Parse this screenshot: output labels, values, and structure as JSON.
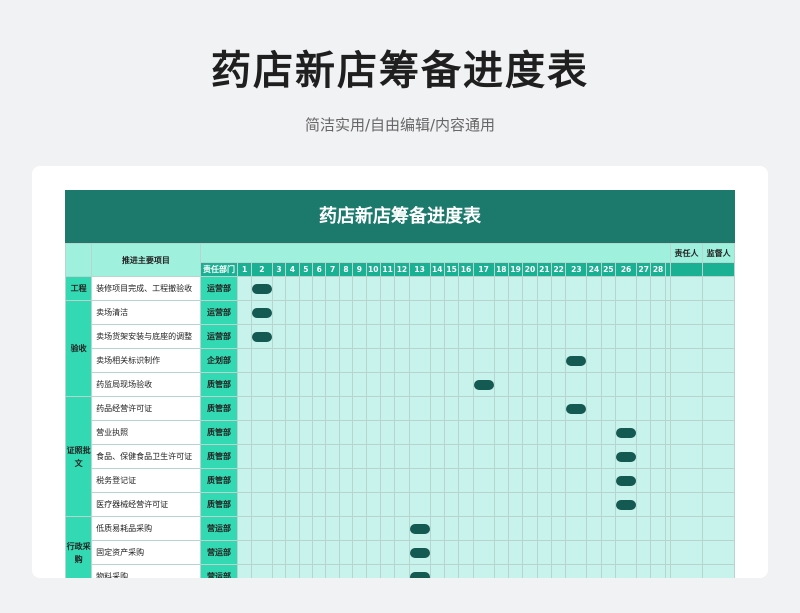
{
  "page": {
    "title": "药店新店筹备进度表",
    "subtitle": "简洁实用/自由编辑/内容通用"
  },
  "sheet": {
    "title": "药店新店筹备进度表",
    "header": {
      "task_col": "推进主要项目",
      "dept_col": "责任部门",
      "owner": "责任人",
      "supervisor": "监督人"
    },
    "days": [
      "1",
      "2",
      "3",
      "4",
      "5",
      "6",
      "7",
      "8",
      "9",
      "10",
      "11",
      "12",
      "13",
      "14",
      "15",
      "16",
      "17",
      "18",
      "19",
      "20",
      "21",
      "22",
      "23",
      "24",
      "25",
      "26",
      "27",
      "28"
    ],
    "categories": [
      {
        "label": "工程",
        "rows": 1
      },
      {
        "label": "验收",
        "rows": 4
      },
      {
        "label": "证照批文",
        "rows": 5
      },
      {
        "label": "行政采购",
        "rows": 3
      }
    ],
    "rows": [
      {
        "task": "装修项目完成、工程撤验收",
        "dept": "运营部",
        "day": 2
      },
      {
        "task": "卖场清洁",
        "dept": "运营部",
        "day": 2
      },
      {
        "task": "卖场货架安装与底座的调整",
        "dept": "运营部",
        "day": 2
      },
      {
        "task": "卖场相关标识制作",
        "dept": "企划部",
        "day": 23
      },
      {
        "task": "药监局现场验收",
        "dept": "质管部",
        "day": 17
      },
      {
        "task": "药品经营许可证",
        "dept": "质管部",
        "day": 23
      },
      {
        "task": "营业执照",
        "dept": "质管部",
        "day": 26
      },
      {
        "task": "食品、保健食品卫生许可证",
        "dept": "质管部",
        "day": 26
      },
      {
        "task": "税务登记证",
        "dept": "质管部",
        "day": 26
      },
      {
        "task": "医疗器械经营许可证",
        "dept": "质管部",
        "day": 26
      },
      {
        "task": "低质易耗品采购",
        "dept": "营运部",
        "day": 13
      },
      {
        "task": "固定资产采购",
        "dept": "营运部",
        "day": 13
      },
      {
        "task": "物料采购",
        "dept": "营运部",
        "day": 13
      }
    ],
    "colors": {
      "banner": "#1b7a6c",
      "cell": "#c8f2ec",
      "accent": "#33d9b2",
      "header_dark": "#19b093",
      "pill": "#145a52"
    }
  }
}
